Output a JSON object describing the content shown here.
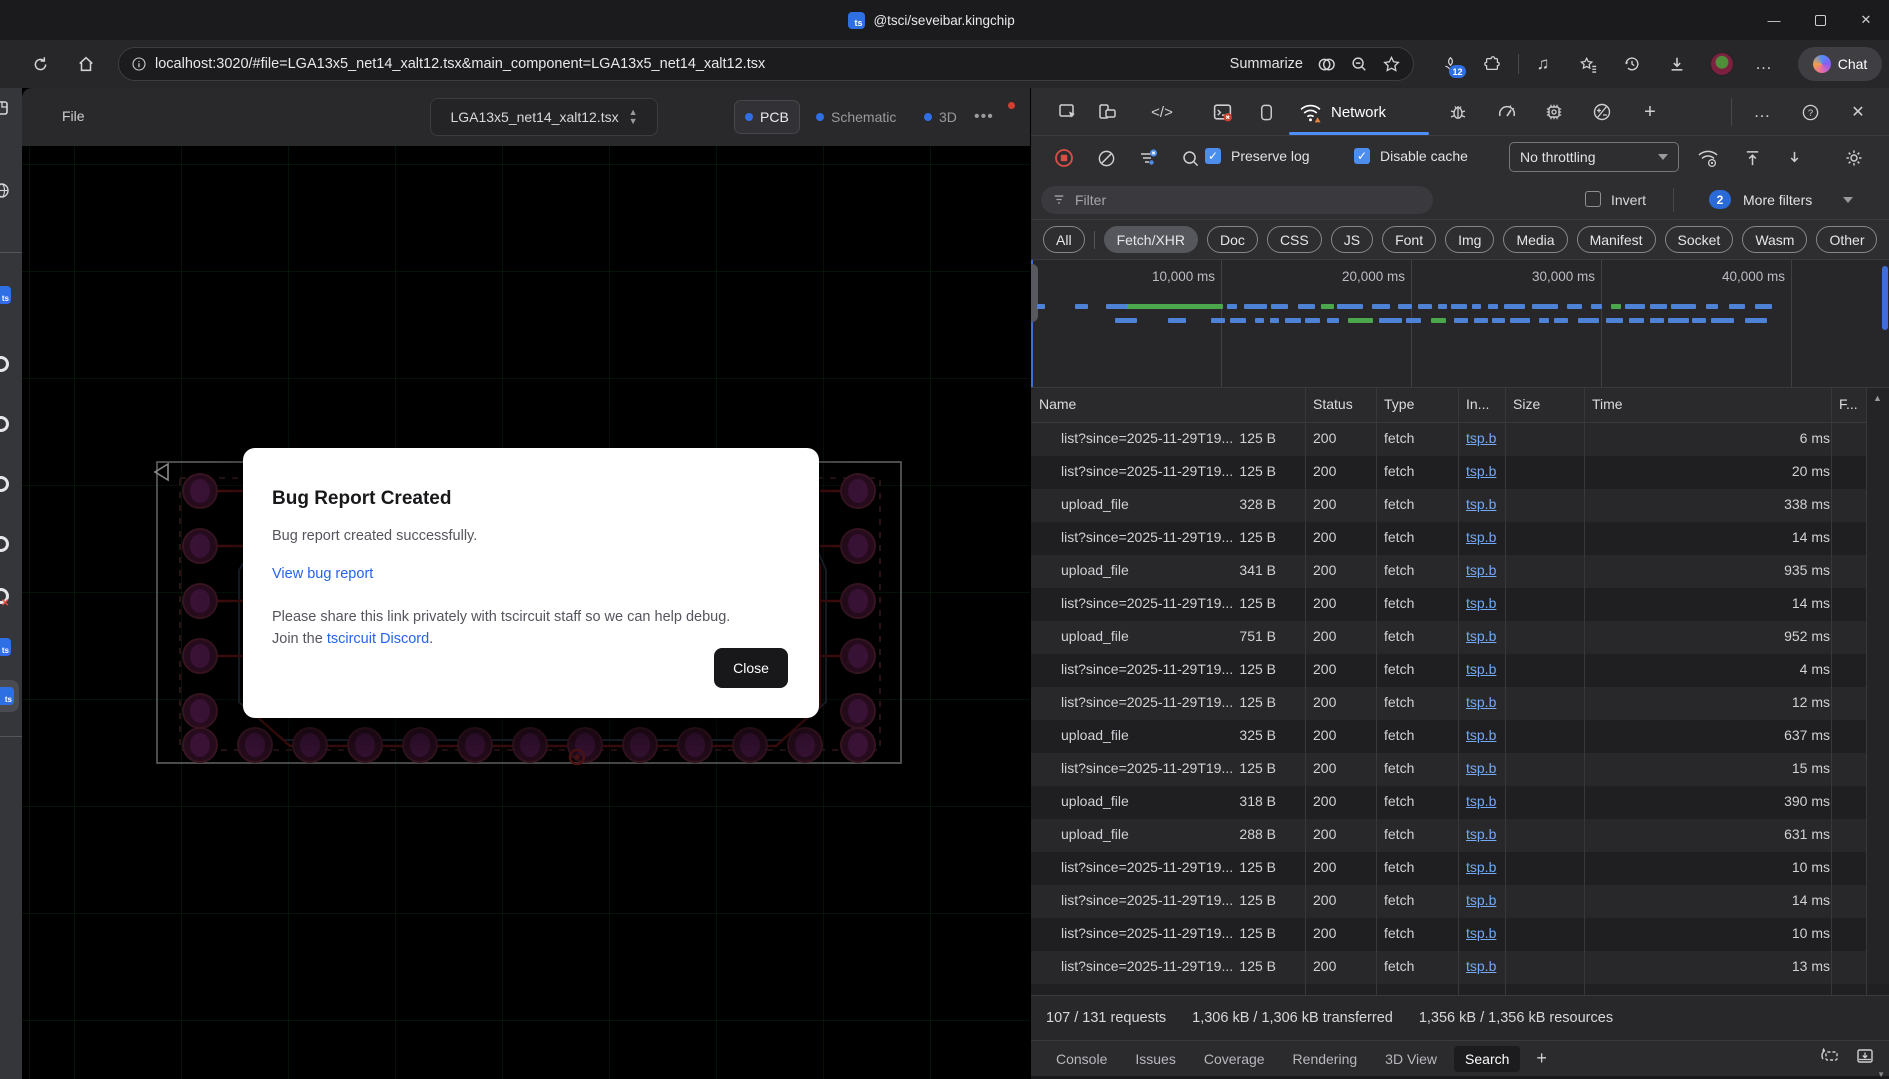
{
  "titlebar": {
    "favicon_text": "ts",
    "tab_title": "@tsci/seveibar.kingchip"
  },
  "toolbar": {
    "url": "localhost:3020/#file=LGA13x5_net14_xalt12.tsx&main_component=LGA13x5_net14_xalt12.tsx",
    "summarize_label": "Summarize",
    "extensions_badge": "12",
    "chat_label": "Chat"
  },
  "app": {
    "file_menu_label": "File",
    "file_selector_value": "LGA13x5_net14_xalt12.tsx",
    "view_tabs": [
      {
        "label": "PCB",
        "active": true
      },
      {
        "label": "Schematic",
        "active": false
      },
      {
        "label": "3D",
        "active": false
      }
    ]
  },
  "modal": {
    "title": "Bug Report Created",
    "body": "Bug report created successfully.",
    "link_label": "View bug report",
    "share_line1": "Please share this link privately with tscircuit staff so we can help debug.",
    "share_line2_prefix": "Join the ",
    "share_link_label": "tscircuit Discord",
    "share_line2_suffix": ".",
    "close_label": "Close"
  },
  "devtools": {
    "network_tab_label": "Network",
    "controls": {
      "preserve_log_label": "Preserve log",
      "disable_cache_label": "Disable cache",
      "throttling_value": "No throttling"
    },
    "filter": {
      "placeholder": "Filter",
      "invert_label": "Invert",
      "more_filters_count": "2",
      "more_filters_label": "More filters"
    },
    "type_pills": [
      {
        "label": "All",
        "active": false
      },
      {
        "label": "Fetch/XHR",
        "active": true
      },
      {
        "label": "Doc",
        "active": false
      },
      {
        "label": "CSS",
        "active": false
      },
      {
        "label": "JS",
        "active": false
      },
      {
        "label": "Font",
        "active": false
      },
      {
        "label": "Img",
        "active": false
      },
      {
        "label": "Media",
        "active": false
      },
      {
        "label": "Manifest",
        "active": false
      },
      {
        "label": "Socket",
        "active": false
      },
      {
        "label": "Wasm",
        "active": false
      },
      {
        "label": "Other",
        "active": false
      }
    ],
    "timeline": {
      "ticks": [
        "10,000 ms",
        "20,000 ms",
        "30,000 ms",
        "40,000 ms"
      ],
      "tick_positions": [
        190,
        380,
        570,
        760
      ]
    },
    "table": {
      "columns": [
        "Name",
        "Status",
        "Type",
        "In...",
        "Size",
        "Time",
        "F..."
      ],
      "rows": [
        {
          "name": "list?since=2025-11-29T19...",
          "status": "200",
          "type": "fetch",
          "initiator": "tsp.b",
          "size": "125 B",
          "time": "6 ms"
        },
        {
          "name": "list?since=2025-11-29T19...",
          "status": "200",
          "type": "fetch",
          "initiator": "tsp.b",
          "size": "125 B",
          "time": "20 ms"
        },
        {
          "name": "upload_file",
          "status": "200",
          "type": "fetch",
          "initiator": "tsp.b",
          "size": "328 B",
          "time": "338 ms"
        },
        {
          "name": "list?since=2025-11-29T19...",
          "status": "200",
          "type": "fetch",
          "initiator": "tsp.b",
          "size": "125 B",
          "time": "14 ms"
        },
        {
          "name": "upload_file",
          "status": "200",
          "type": "fetch",
          "initiator": "tsp.b",
          "size": "341 B",
          "time": "935 ms"
        },
        {
          "name": "list?since=2025-11-29T19...",
          "status": "200",
          "type": "fetch",
          "initiator": "tsp.b",
          "size": "125 B",
          "time": "14 ms"
        },
        {
          "name": "upload_file",
          "status": "200",
          "type": "fetch",
          "initiator": "tsp.b",
          "size": "751 B",
          "time": "952 ms"
        },
        {
          "name": "list?since=2025-11-29T19...",
          "status": "200",
          "type": "fetch",
          "initiator": "tsp.b",
          "size": "125 B",
          "time": "4 ms"
        },
        {
          "name": "list?since=2025-11-29T19...",
          "status": "200",
          "type": "fetch",
          "initiator": "tsp.b",
          "size": "125 B",
          "time": "12 ms"
        },
        {
          "name": "upload_file",
          "status": "200",
          "type": "fetch",
          "initiator": "tsp.b",
          "size": "325 B",
          "time": "637 ms"
        },
        {
          "name": "list?since=2025-11-29T19...",
          "status": "200",
          "type": "fetch",
          "initiator": "tsp.b",
          "size": "125 B",
          "time": "15 ms"
        },
        {
          "name": "upload_file",
          "status": "200",
          "type": "fetch",
          "initiator": "tsp.b",
          "size": "318 B",
          "time": "390 ms"
        },
        {
          "name": "upload_file",
          "status": "200",
          "type": "fetch",
          "initiator": "tsp.b",
          "size": "288 B",
          "time": "631 ms"
        },
        {
          "name": "list?since=2025-11-29T19...",
          "status": "200",
          "type": "fetch",
          "initiator": "tsp.b",
          "size": "125 B",
          "time": "10 ms"
        },
        {
          "name": "list?since=2025-11-29T19...",
          "status": "200",
          "type": "fetch",
          "initiator": "tsp.b",
          "size": "125 B",
          "time": "14 ms"
        },
        {
          "name": "list?since=2025-11-29T19...",
          "status": "200",
          "type": "fetch",
          "initiator": "tsp.b",
          "size": "125 B",
          "time": "10 ms"
        },
        {
          "name": "list?since=2025-11-29T19...",
          "status": "200",
          "type": "fetch",
          "initiator": "tsp.b",
          "size": "125 B",
          "time": "13 ms"
        }
      ]
    },
    "summary": {
      "requests": "107 / 131 requests",
      "transferred": "1,306 kB / 1,306 kB transferred",
      "resources": "1,356 kB / 1,356 kB resources"
    },
    "bottom_tabs": [
      {
        "label": "Console",
        "active": false
      },
      {
        "label": "Issues",
        "active": false
      },
      {
        "label": "Coverage",
        "active": false
      },
      {
        "label": "Rendering",
        "active": false
      },
      {
        "label": "3D View",
        "active": false
      },
      {
        "label": "Search",
        "active": true
      }
    ]
  },
  "colors": {
    "accent_blue": "#4e8ef7",
    "checkbox_blue": "#4c8ded",
    "badge_blue": "#2b6bd8",
    "ts_blue": "#2f6fe4",
    "warning_orange": "#e8833a",
    "record_red": "#d94f46",
    "table_link_blue": "#74a9f5",
    "modal_link_blue": "#2563eb",
    "waterfall_blue": "#4d82d6",
    "waterfall_green": "#4ca64c"
  }
}
